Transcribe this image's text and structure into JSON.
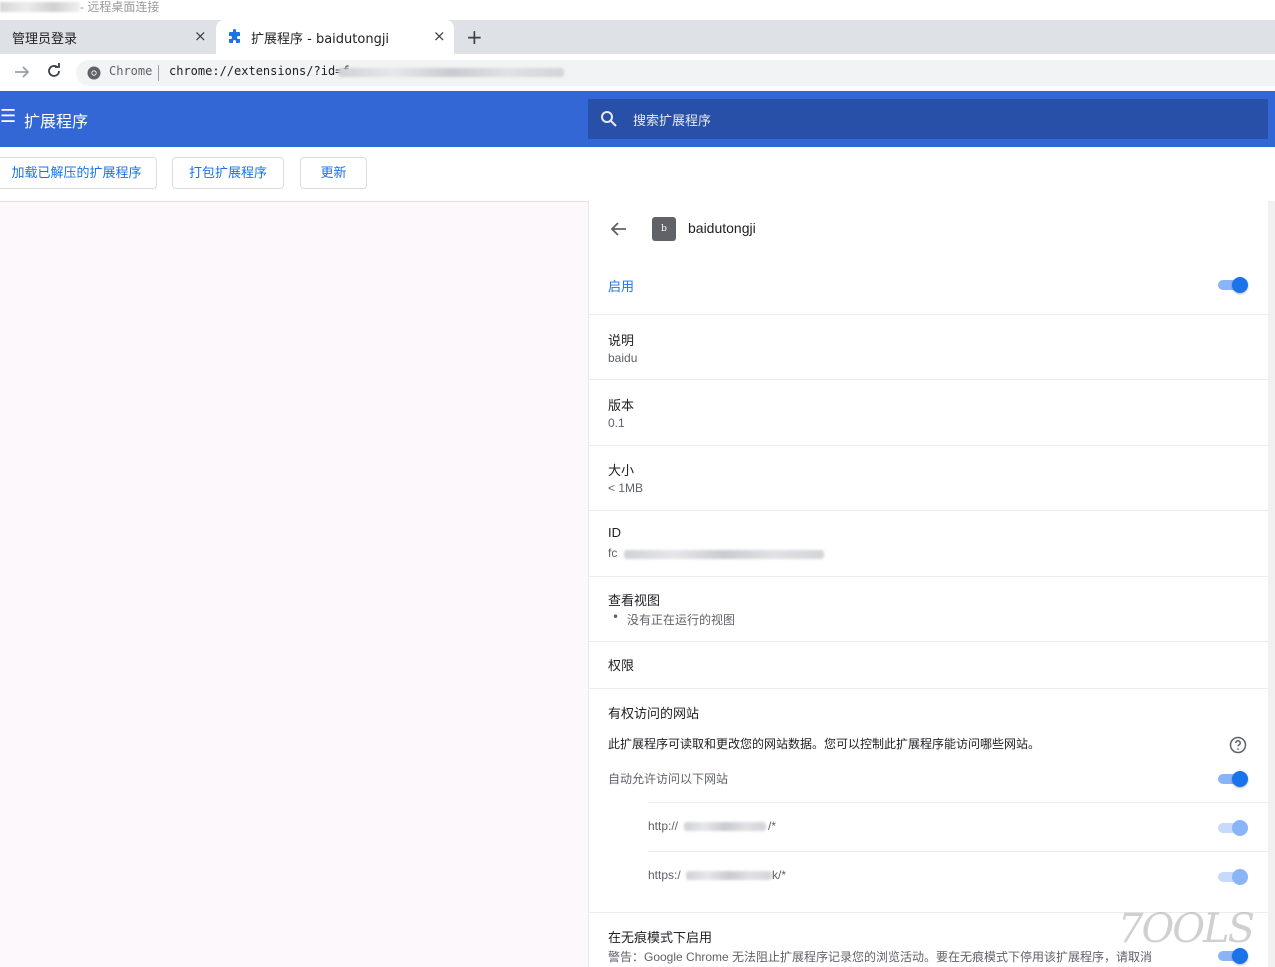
{
  "window": {
    "caption_suffix": "- 远程桌面连接"
  },
  "tabs": [
    {
      "label": "管理员登录",
      "close": "×"
    },
    {
      "label": "扩展程序 - baidutongji",
      "close": "×",
      "icon": "puzzle-icon"
    }
  ],
  "new_tab": "+",
  "toolbar": {
    "site_name": "Chrome",
    "url": "chrome://extensions/?id=f"
  },
  "header": {
    "menu_icon": "☰",
    "title": "扩展程序",
    "search_placeholder": "搜索扩展程序"
  },
  "dev_buttons": {
    "load_unpacked": "加载已解压的扩展程序",
    "pack": "打包扩展程序",
    "update": "更新"
  },
  "detail": {
    "ext_icon_letter": "b",
    "ext_name": "baidutongji",
    "enable_label": "启用",
    "description_title": "说明",
    "description_value": "baidu",
    "version_title": "版本",
    "version_value": "0.1",
    "size_title": "大小",
    "size_value": "< 1MB",
    "id_title": "ID",
    "id_value": "fc",
    "views_title": "查看视图",
    "views_value": "没有正在运行的视图",
    "permissions_title": "权限",
    "site_access_title": "有权访问的网站",
    "site_access_desc": "此扩展程序可读取和更改您的网站数据。您可以控制此扩展程序能访问哪些网站。",
    "auto_allow_label": "自动允许访问以下网站",
    "sites": [
      {
        "prefix": "http://",
        "suffix": "/*"
      },
      {
        "prefix": "https:/",
        "suffix": "k/*"
      }
    ],
    "incognito_title": "在无痕模式下启用",
    "incognito_warning": "警告：Google Chrome 无法阻止扩展程序记录您的浏览活动。要在无痕模式下停用该扩展程序，请取消"
  },
  "watermark": "7OOLS",
  "colors": {
    "header_blue": "#3367d6",
    "search_blue": "#2850a8",
    "accent": "#1a73e8"
  }
}
